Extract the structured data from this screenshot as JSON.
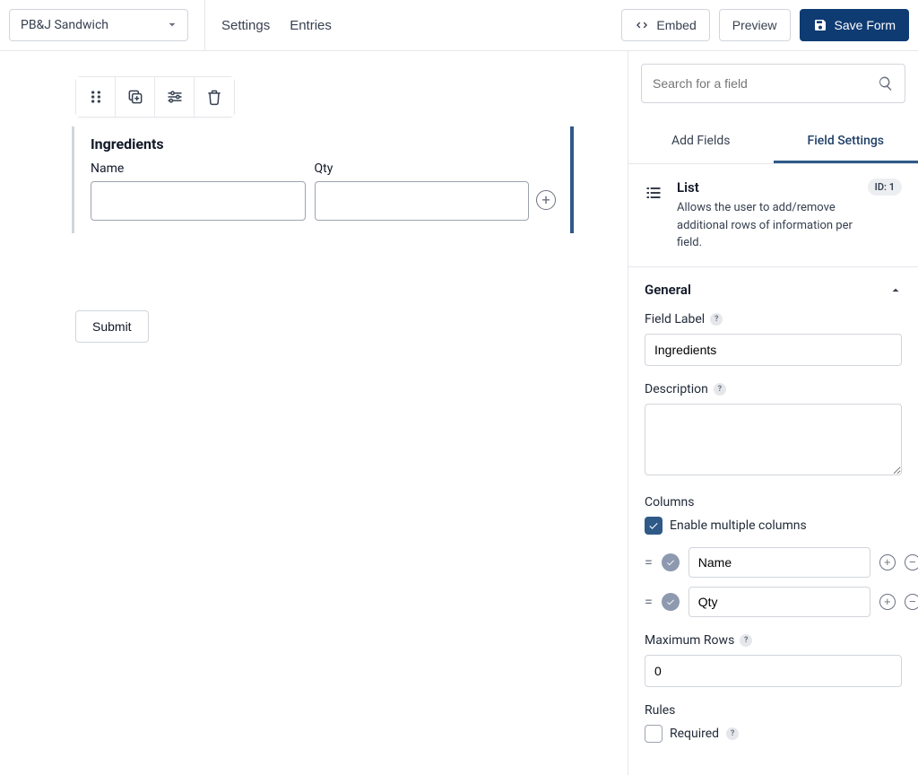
{
  "topbar": {
    "form_name": "PB&J Sandwich",
    "settings_label": "Settings",
    "entries_label": "Entries",
    "embed_label": "Embed",
    "preview_label": "Preview",
    "save_label": "Save Form"
  },
  "canvas": {
    "field_title": "Ingredients",
    "col1_label": "Name",
    "col2_label": "Qty",
    "submit_label": "Submit"
  },
  "sidebar": {
    "search_placeholder": "Search for a field",
    "tab_add": "Add Fields",
    "tab_settings": "Field Settings",
    "field_type": "List",
    "field_desc": "Allows the user to add/remove additional rows of information per field.",
    "id_label": "ID: 1",
    "general": {
      "title": "General",
      "field_label_label": "Field Label",
      "field_label_value": "Ingredients",
      "description_label": "Description",
      "description_value": "",
      "columns_label": "Columns",
      "enable_multiple_label": "Enable multiple columns",
      "columns": [
        {
          "name": "Name"
        },
        {
          "name": "Qty"
        }
      ],
      "max_rows_label": "Maximum Rows",
      "max_rows_value": "0",
      "rules_label": "Rules",
      "required_label": "Required"
    }
  }
}
